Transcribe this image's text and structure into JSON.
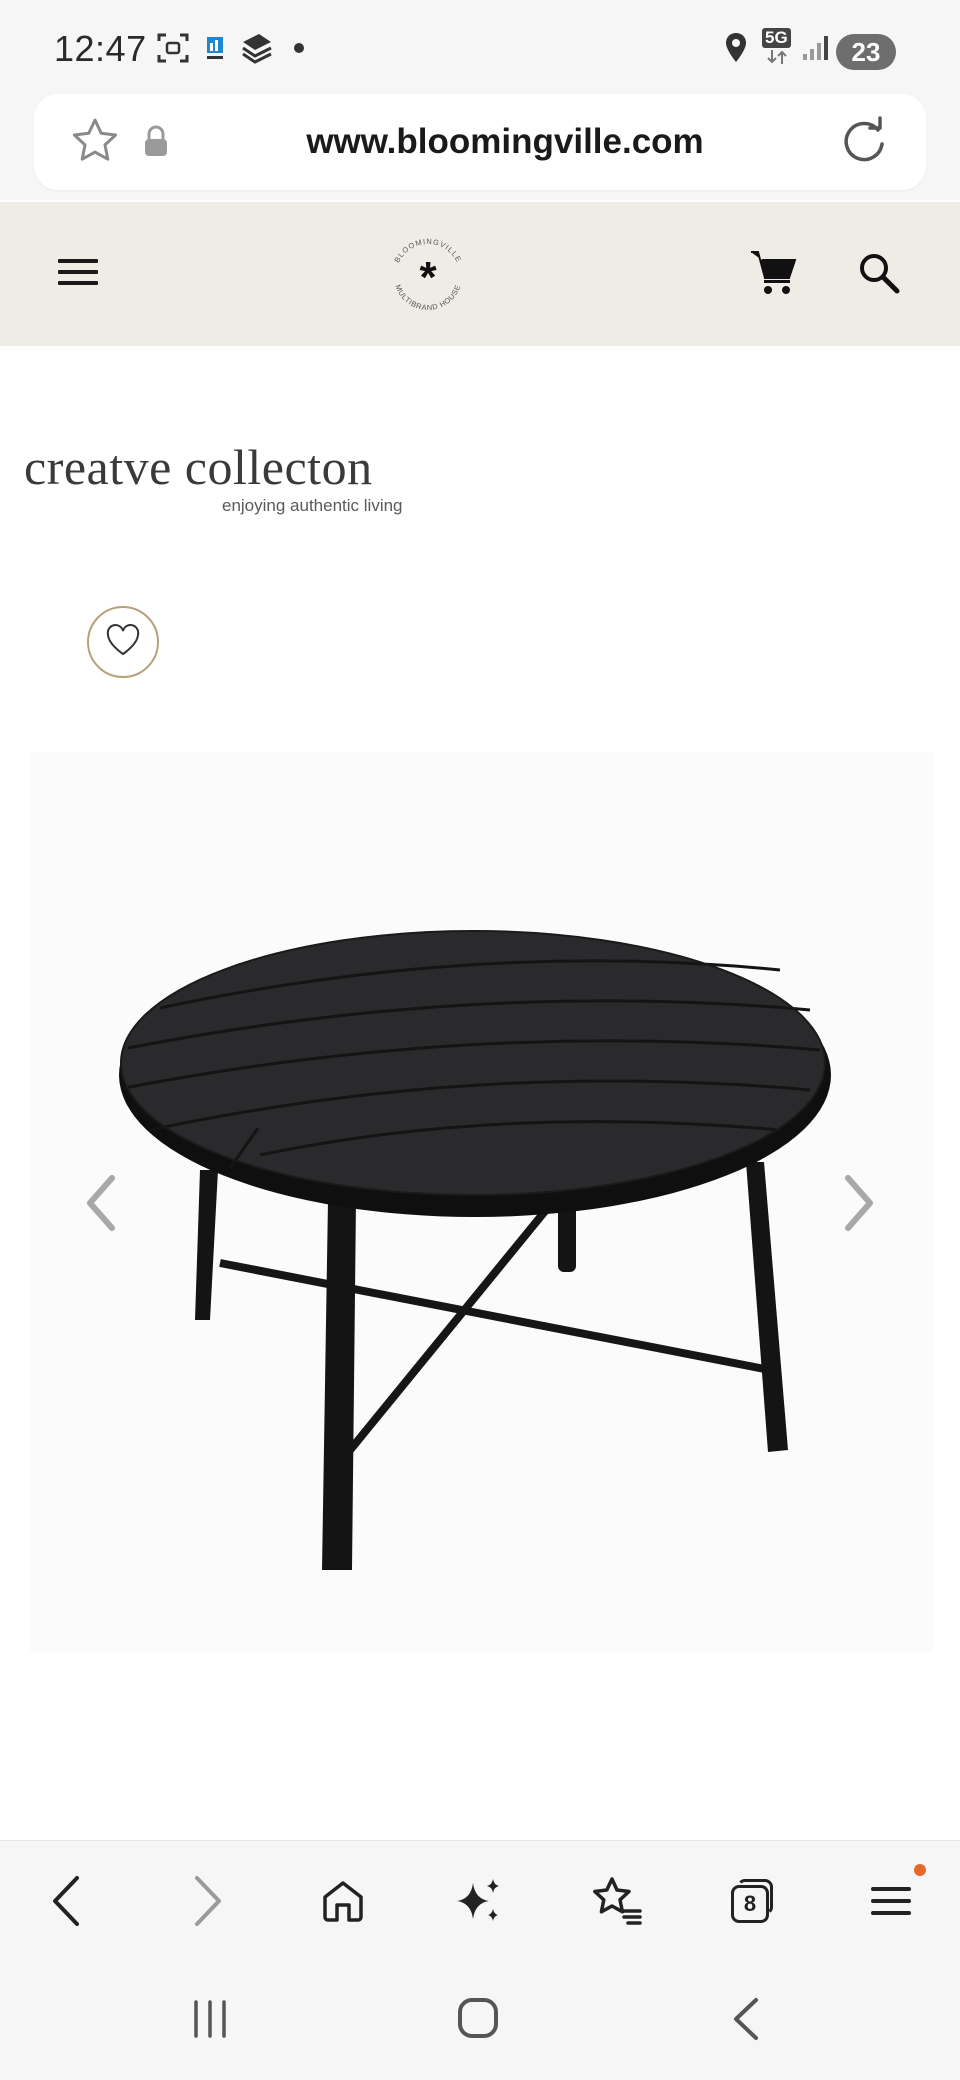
{
  "status_bar": {
    "time": "12:47",
    "network": "5G",
    "battery": "23",
    "icons": [
      "screenshot-icon",
      "app-notification-icon",
      "layers-icon",
      "dot-icon",
      "location-icon",
      "network-5g-icon",
      "signal-icon",
      "battery-icon"
    ]
  },
  "browser": {
    "url": "www.bloomingville.com",
    "icons": [
      "star-icon",
      "lock-icon",
      "reload-icon"
    ]
  },
  "site_header": {
    "logo_ring_top": "BLOOMINGVILLE",
    "logo_ring_bottom": "MULTIBRAND HOUSE",
    "logo_symbol": "*",
    "icons": [
      "menu-icon",
      "cart-icon",
      "search-icon"
    ]
  },
  "brand": {
    "title": "creatve collecton",
    "subtitle": "enjoying authentic living"
  },
  "product": {
    "image_alt": "Round black wooden table",
    "icons": [
      "heart-icon",
      "chevron-left-icon",
      "chevron-right-icon"
    ]
  },
  "bottom_nav": {
    "tabs_count": "8",
    "icons": [
      "back-icon",
      "forward-icon",
      "home-icon",
      "sparkle-icon",
      "bookmarks-icon",
      "tabs-icon",
      "menu-icon"
    ]
  },
  "system_nav": {
    "icons": [
      "recents-icon",
      "home-icon",
      "back-icon"
    ]
  },
  "colors": {
    "header_bg": "#efece6",
    "wishlist_border": "#b5a17c",
    "notification_dot": "#e8682c"
  }
}
